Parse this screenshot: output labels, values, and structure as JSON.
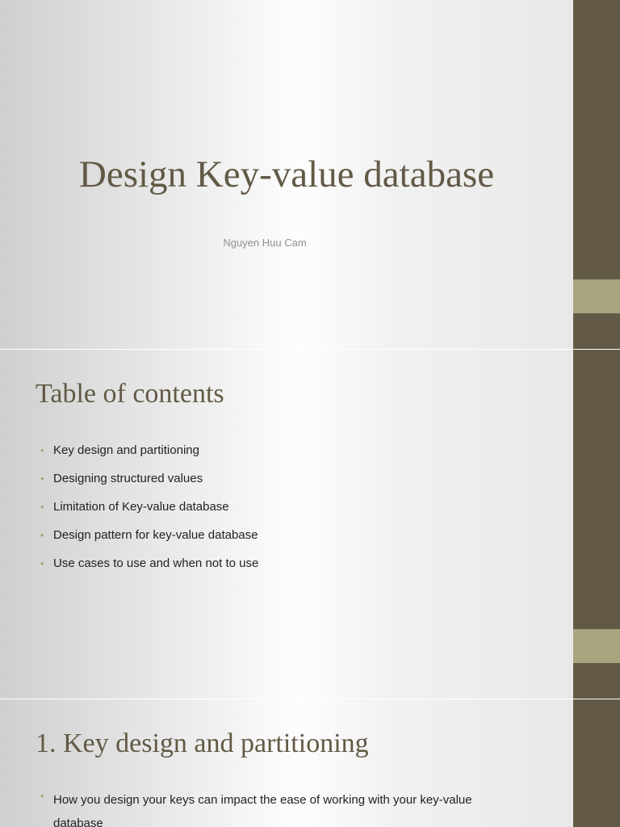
{
  "theme": {
    "bar_color": "#625a46",
    "accent_color": "#a7a47e",
    "title_color": "#625a46"
  },
  "slide1": {
    "title": "Design Key-value database",
    "subtitle": "Nguyen Huu Cam"
  },
  "slide2": {
    "heading": "Table of contents",
    "bullets": [
      "Key design and partitioning",
      "Designing structured values",
      "Limitation of Key-value database",
      "Design pattern for key-value database",
      "Use cases to use and when not to use"
    ]
  },
  "slide3": {
    "heading": "1. Key design and partitioning",
    "bullets": [
      "How you design your keys can impact the ease of working with your key-value database"
    ]
  },
  "bullet_glyph": "•"
}
